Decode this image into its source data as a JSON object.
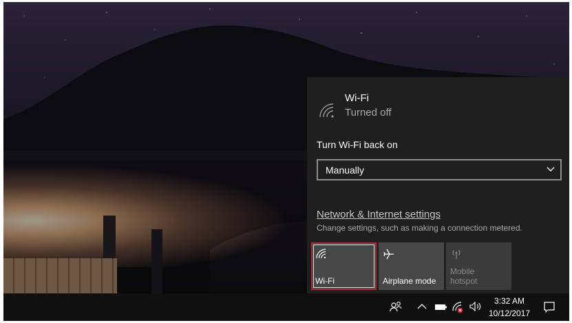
{
  "wifi_flyout": {
    "title": "Wi-Fi",
    "status": "Turned off",
    "turn_on_label": "Turn Wi-Fi back on",
    "turn_on_selected": "Manually",
    "settings_link": "Network & Internet settings",
    "settings_description": "Change settings, such as making a connection metered."
  },
  "quick_actions": [
    {
      "label": "Wi-Fi",
      "icon": "wifi-icon",
      "state": "off",
      "selected": true
    },
    {
      "label": "Airplane mode",
      "icon": "airplane-icon",
      "state": "off"
    },
    {
      "label": "Mobile\nhotspot",
      "icon": "mobile-hotspot-icon",
      "state": "disabled"
    }
  ],
  "taskbar": {
    "tray_icons": [
      "people-icon",
      "chevron-up-icon",
      "battery-icon",
      "network-disabled-icon",
      "volume-icon",
      "action-center-icon"
    ],
    "time": "3:32 AM",
    "date": "10/12/2017"
  },
  "colors": {
    "flyout_bg": "#1f1f1f",
    "tile_bg": "#474747",
    "highlight_border": "#b0283f",
    "taskbar_bg": "#101010"
  }
}
